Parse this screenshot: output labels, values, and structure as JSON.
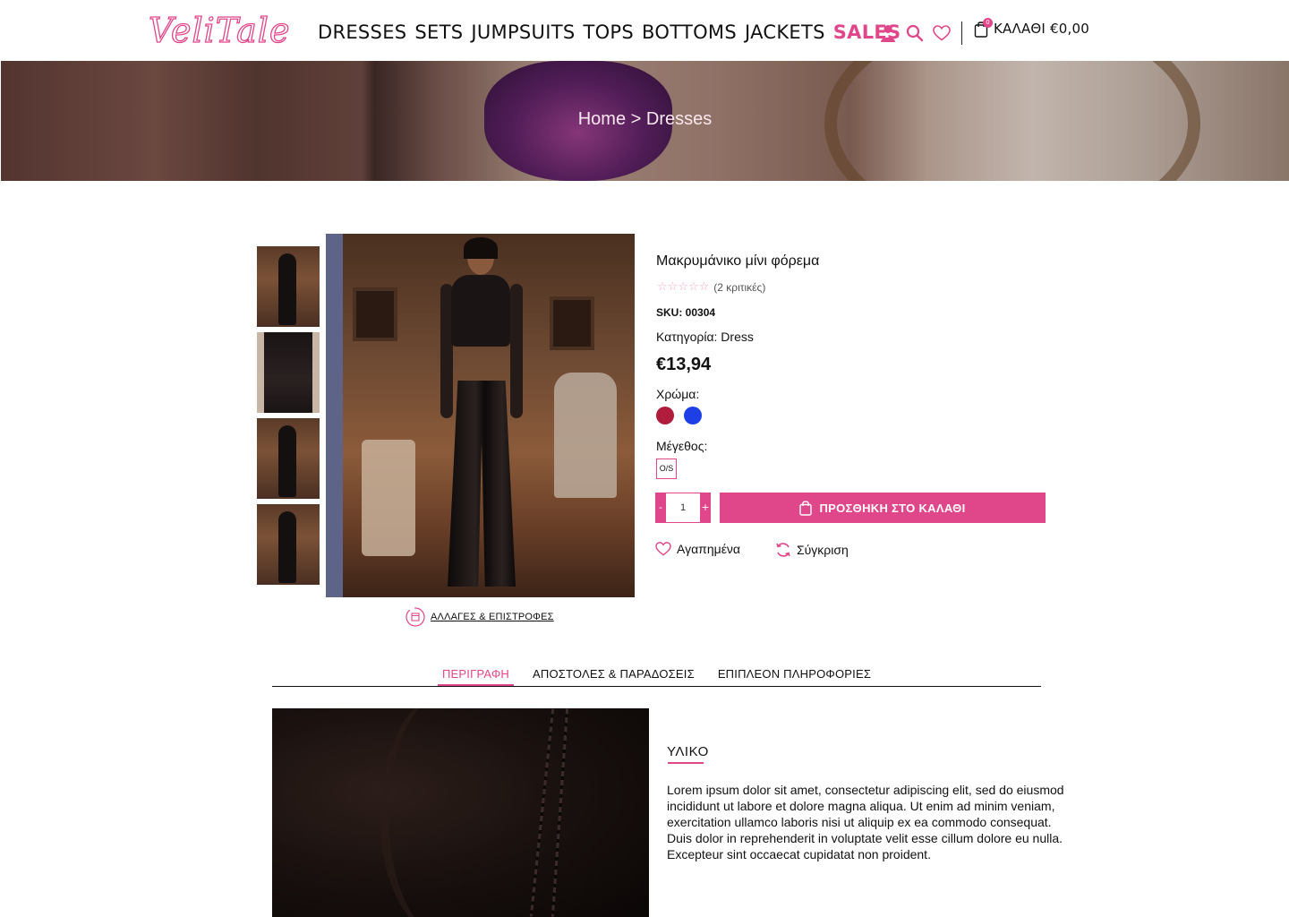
{
  "brand": {
    "logo_text": "VeliTale",
    "accent_color": "#e0478a"
  },
  "nav": {
    "items": [
      "DRESSES",
      "SETS",
      "JUMPSUITS",
      "TOPS",
      "BOTTOMS",
      "JACKETS",
      "SALES"
    ]
  },
  "header_icons": [
    "user-icon",
    "search-icon",
    "heart-icon"
  ],
  "cart": {
    "count": "0",
    "label": "ΚΑΛΑΘΙ €0,00"
  },
  "breadcrumb": {
    "home": "Home",
    "separator": " > ",
    "current": "Dresses"
  },
  "product": {
    "title": "Μακρυμάνικο μίνι φόρεμα",
    "rating": 0,
    "reviews": "(2 κριτικές)",
    "sku": "SKU: 00304",
    "category": "Κατηγορία: Dress",
    "price": "€13,94",
    "color_label": "Χρώμα:",
    "colors": [
      "#b01c3c",
      "#1f3fe6"
    ],
    "size_label": "Μέγεθος:",
    "sizes": [
      "O/S"
    ],
    "quantity": "1",
    "qty_minus": "-",
    "qty_plus": "+",
    "add_to_cart": "ΠΡΟΣΘΗΚΗ ΣΤΟ ΚΑΛΑΘΙ",
    "favorites": "Αγαπημένα",
    "compare": "Σύγκριση",
    "returns": "ΑΛΛΑΓΕΣ & ΕΠΙΣΤΡΟΦΕΣ",
    "thumbnails_count": 4
  },
  "tabs": [
    "ΠΕΡΙΓΡΑΦΗ",
    "ΑΠΟΣΤΟΛΕΣ & ΠΑΡΑΔΟΣΕΙΣ",
    "ΕΠΙΠΛΕΟΝ ΠΛΗΡΟΦΟΡΙΕΣ"
  ],
  "active_tab": 0,
  "description": {
    "section_title": "ΥΛΙΚΟ",
    "text": "Lorem ipsum dolor sit amet, consectetur adipiscing elit, sed do eiusmod incididunt ut labore et dolore magna aliqua. Ut enim ad minim veniam, exercitation ullamco laboris nisi ut aliquip ex ea commodo consequat. Duis dolor in reprehenderit in voluptate velit esse cillum dolore eu nulla. Excepteur sint occaecat cupidatat non proident."
  }
}
